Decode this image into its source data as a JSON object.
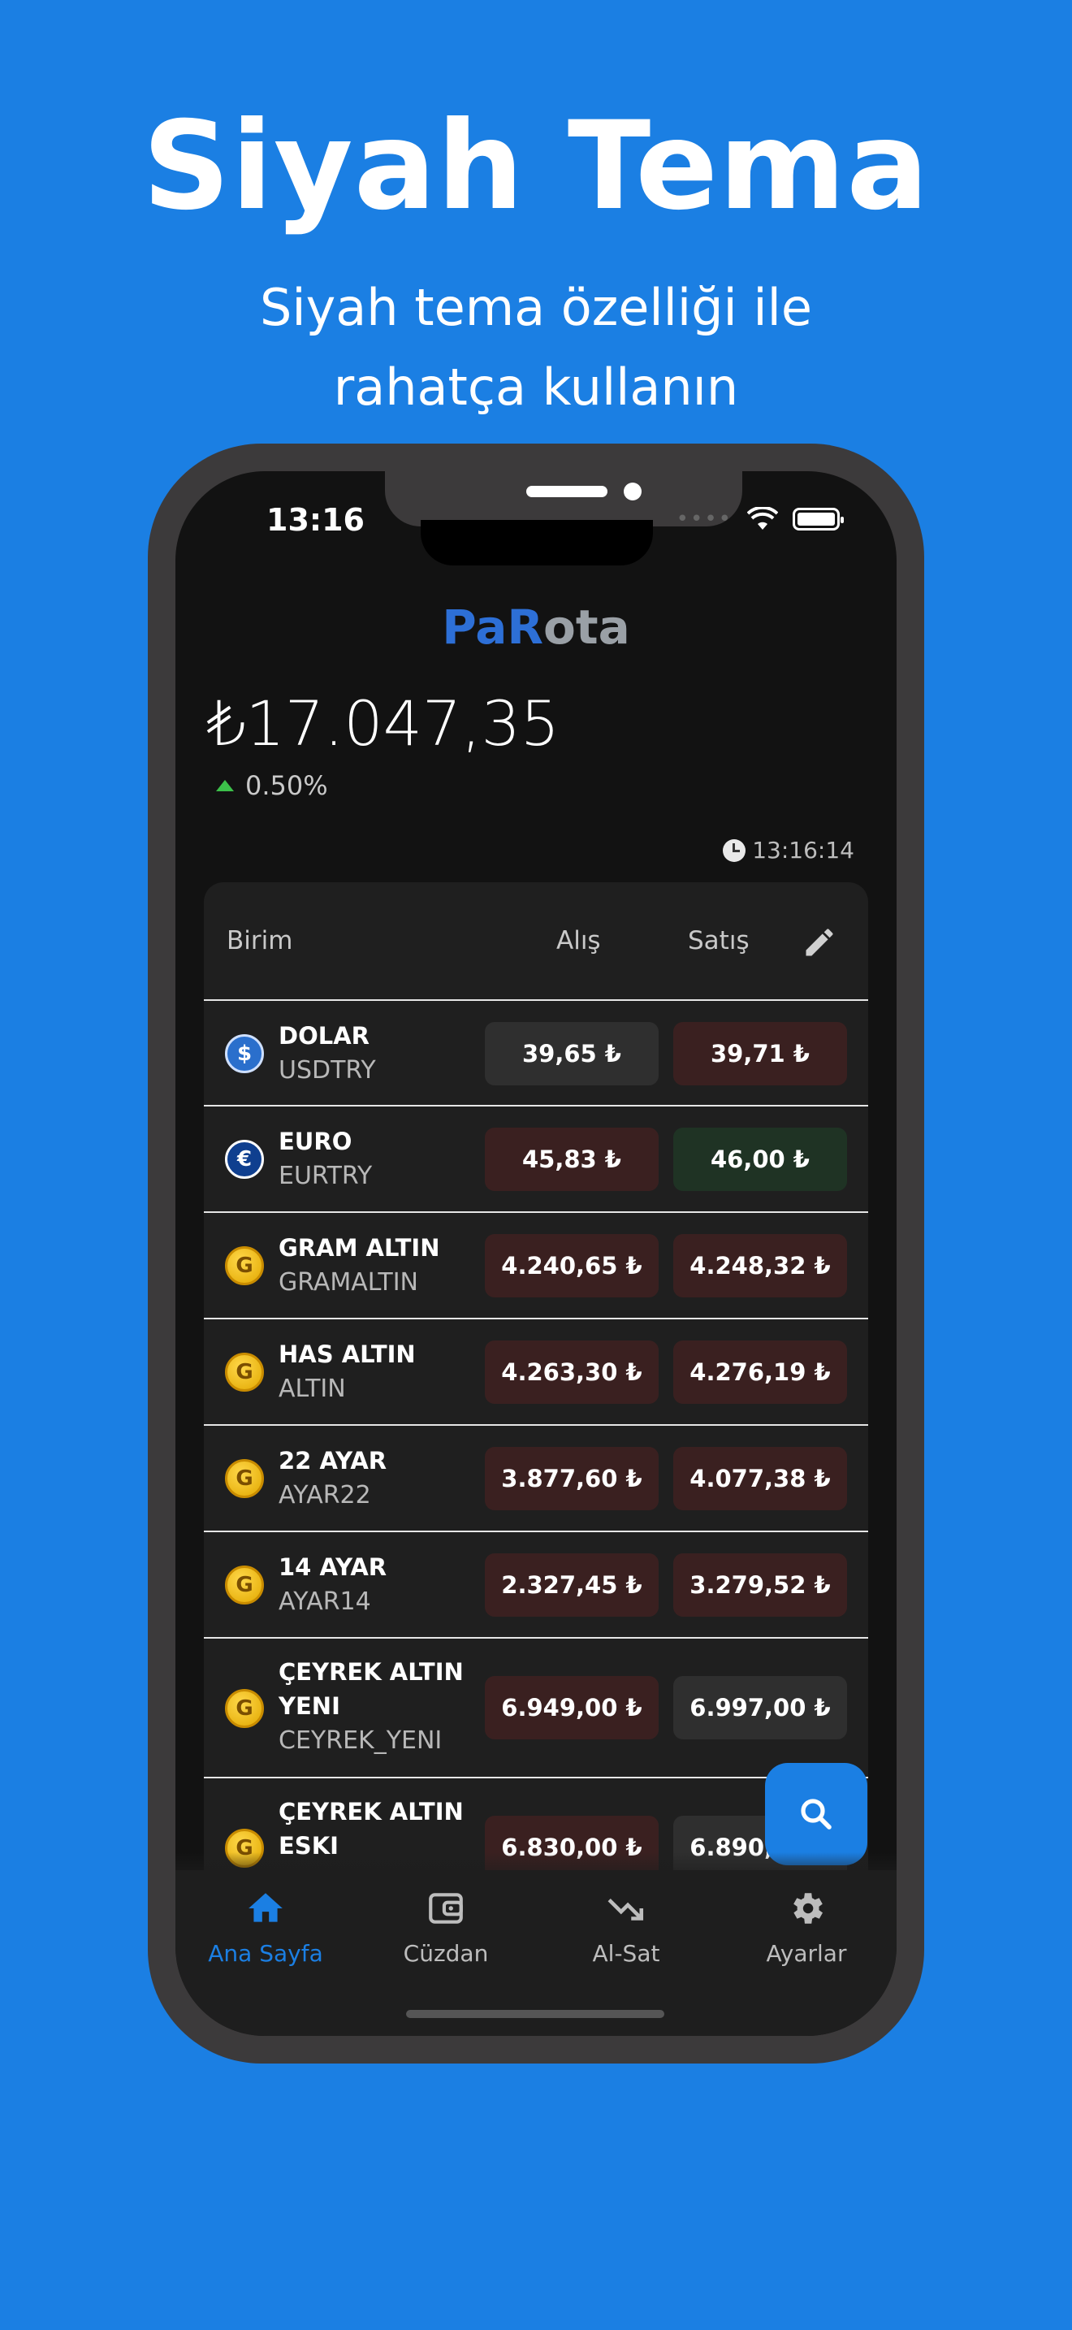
{
  "hero": {
    "title": "Siyah Tema",
    "subtitle_line1": "Siyah tema özelliği ile",
    "subtitle_line2": "rahatça kullanın"
  },
  "status_bar": {
    "time": "13:16",
    "dots": "••••"
  },
  "app": {
    "logo_part1": "Pa",
    "logo_part2": "R",
    "logo_part3": "ota",
    "balance": "₺17.047,35",
    "change": "0.50%",
    "updated_time": "13:16:14"
  },
  "table": {
    "headers": {
      "unit": "Birim",
      "buy": "Alış",
      "sell": "Satış"
    },
    "rows": [
      {
        "name": "DOLAR",
        "code": "USDTRY",
        "buy": "39,65 ₺",
        "sell": "39,71 ₺",
        "icon": "dollar-coin-icon"
      },
      {
        "name": "EURO",
        "code": "EURTRY",
        "buy": "45,83 ₺",
        "sell": "46,00 ₺",
        "icon": "euro-coin-icon"
      },
      {
        "name": "GRAM ALTIN",
        "code": "GRAMALTIN",
        "buy": "4.240,65 ₺",
        "sell": "4.248,32 ₺",
        "icon": "gold-coin-icon"
      },
      {
        "name": "HAS ALTIN",
        "code": "ALTIN",
        "buy": "4.263,30 ₺",
        "sell": "4.276,19 ₺",
        "icon": "gold-coin-icon"
      },
      {
        "name": "22 AYAR",
        "code": "AYAR22",
        "buy": "3.877,60 ₺",
        "sell": "4.077,38 ₺",
        "icon": "gold-coin-icon"
      },
      {
        "name": "14 AYAR",
        "code": "AYAR14",
        "buy": "2.327,45 ₺",
        "sell": "3.279,52 ₺",
        "icon": "gold-coin-icon"
      },
      {
        "name": "ÇEYREK ALTIN YENI",
        "code": "CEYREK_YENI",
        "buy": "6.949,00 ₺",
        "sell": "6.997,00 ₺",
        "icon": "gold-coin-icon"
      },
      {
        "name": "ÇEYREK ALTIN ESKI",
        "code": "",
        "buy": "6.830,00 ₺",
        "sell": "6.890,00 ₺",
        "icon": "gold-coin-icon"
      }
    ]
  },
  "coin_glyphs": {
    "dollar": "$",
    "euro": "€",
    "gold": "G"
  },
  "nav": {
    "home": "Ana Sayfa",
    "wallet": "Cüzdan",
    "trade": "Al-Sat",
    "settings": "Ayarlar"
  },
  "colors": {
    "brand_blue": "#1b7fe3",
    "up_green": "#3cc04a",
    "sell_red_bg": "#3a2020",
    "buy_green_bg": "#1f3324"
  }
}
